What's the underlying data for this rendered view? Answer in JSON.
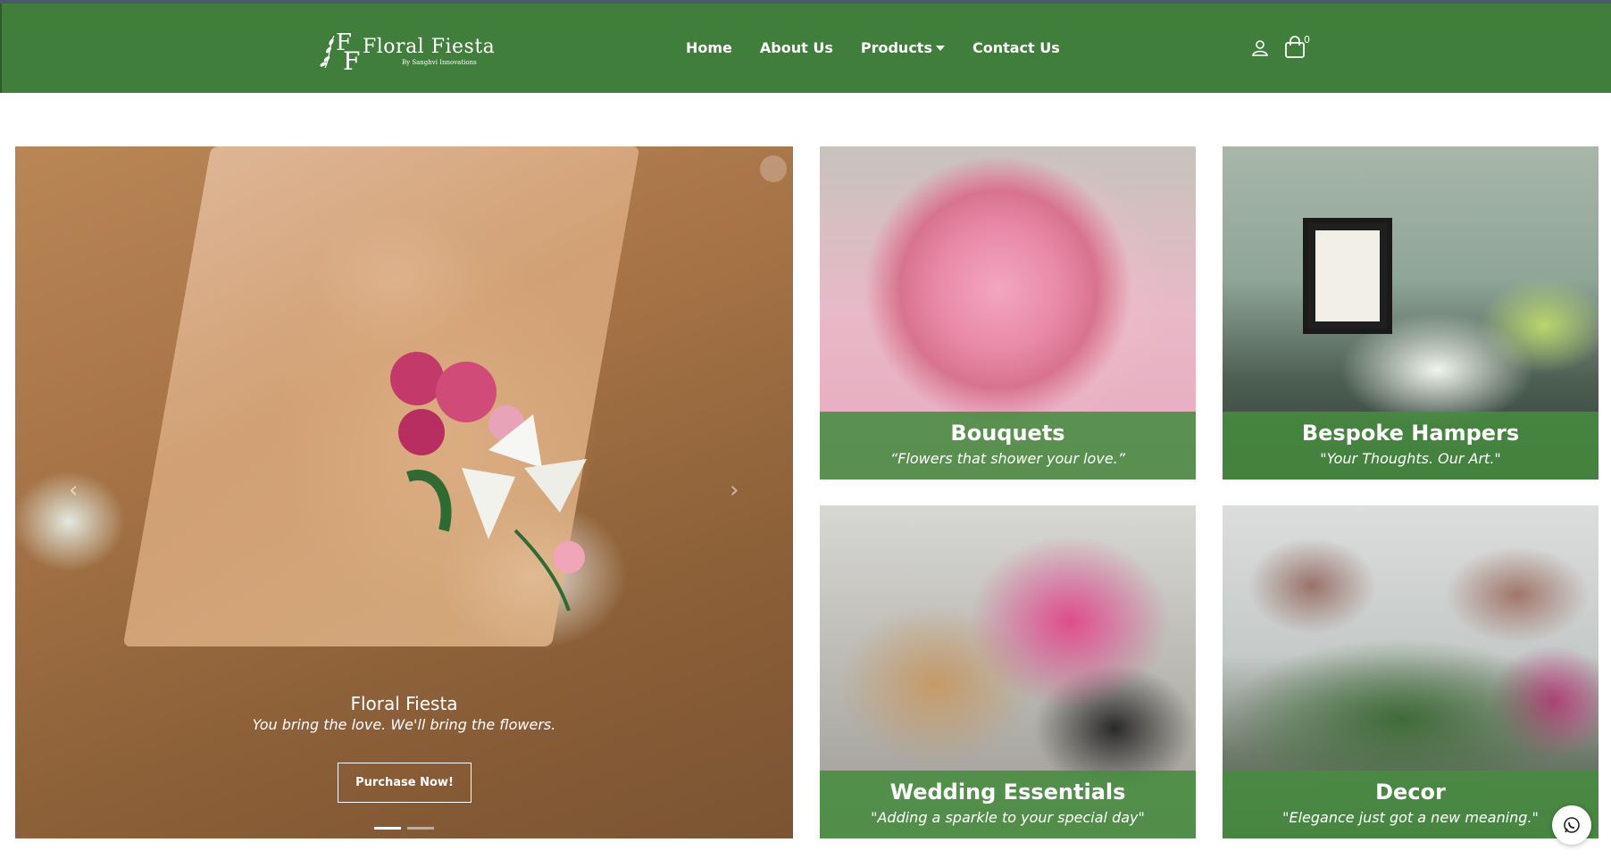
{
  "header": {
    "logo_text": "Floral Fiesta",
    "logo_sub": "By Sanghvi Innovations",
    "nav": [
      {
        "label": "Home"
      },
      {
        "label": "About Us"
      },
      {
        "label": "Products"
      },
      {
        "label": "Contact Us"
      }
    ],
    "cart_count": "0",
    "icons": [
      "user-icon",
      "shopping-bag-icon"
    ]
  },
  "hero": {
    "title": "Floral Fiesta",
    "subtitle": "You bring the love. We'll bring the flowers.",
    "button_label": "Purchase Now!",
    "slides_total": 2,
    "active_slide": 1
  },
  "categories": [
    {
      "title": "Bouquets",
      "tagline": "“Flowers that shower your love.”"
    },
    {
      "title": "Bespoke Hampers",
      "tagline": "\"Your Thoughts. Our Art.\""
    },
    {
      "title": "Wedding Essentials",
      "tagline": "\"Adding a sparkle to your special day\""
    },
    {
      "title": "Decor",
      "tagline": "\"Elegance just got a new meaning.\""
    }
  ],
  "colors": {
    "brand_green": "#3f7e3b",
    "caption_green": "#478c40",
    "white": "#ffffff"
  }
}
